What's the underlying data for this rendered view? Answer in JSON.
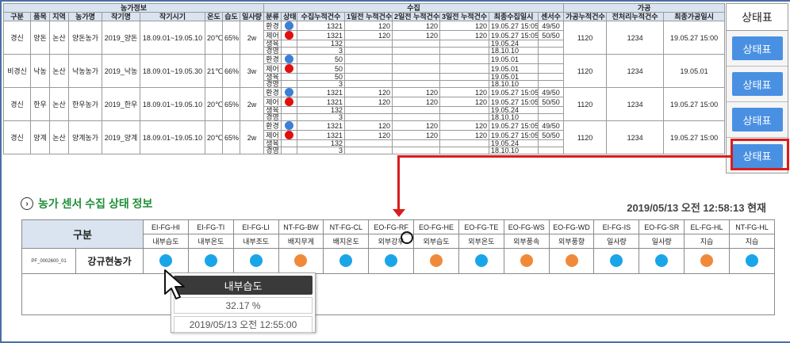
{
  "top": {
    "groups": [
      "농가정보",
      "수집",
      "가공"
    ],
    "columns": [
      "구분",
      "품목",
      "지역",
      "농가명",
      "작기명",
      "작기시기",
      "온도",
      "습도",
      "일사량",
      "분류",
      "상태",
      "수집누적건수",
      "1일전 누적건수",
      "2일전 누적건수",
      "3일전 누적건수",
      "최종수집일시",
      "센서수",
      "가공누적건수",
      "전처리누적건수",
      "최종가공일시"
    ],
    "farms": [
      {
        "gubun": "경신",
        "item": "양돈",
        "region": "논산",
        "name": "양돈농가",
        "crop": "2019_양돈",
        "period": "18.09.01~19.05.10",
        "temp": "20℃",
        "hum": "65%",
        "solar": "2w",
        "rows": [
          {
            "cls": "환경",
            "status": "blue",
            "total": "1321",
            "d1": "120",
            "d2": "120",
            "d3": "120",
            "last": "19.05.27 15:05",
            "sensors": "49/50"
          },
          {
            "cls": "제어",
            "status": "red",
            "total": "1321",
            "d1": "120",
            "d2": "120",
            "d3": "120",
            "last": "19.05.27 15:05",
            "sensors": "50/50"
          },
          {
            "cls": "생육",
            "status": "",
            "total": "132",
            "d1": "",
            "d2": "",
            "d3": "",
            "last": "19.05.24",
            "sensors": ""
          },
          {
            "cls": "경영",
            "status": "",
            "total": "3",
            "d1": "",
            "d2": "",
            "d3": "",
            "last": "18.10.10",
            "sensors": ""
          }
        ],
        "proc": "1120",
        "pre": "1234",
        "plast": "19.05.27 15:00"
      },
      {
        "gubun": "비경신",
        "item": "낙농",
        "region": "논산",
        "name": "낙농농가",
        "crop": "2019_낙농",
        "period": "18.09.01~19.05.30",
        "temp": "21℃",
        "hum": "66%",
        "solar": "3w",
        "rows": [
          {
            "cls": "환경",
            "status": "blue",
            "total": "50",
            "d1": "",
            "d2": "",
            "d3": "",
            "last": "19.05.01",
            "sensors": ""
          },
          {
            "cls": "제어",
            "status": "red",
            "total": "50",
            "d1": "",
            "d2": "",
            "d3": "",
            "last": "19.05.01",
            "sensors": ""
          },
          {
            "cls": "생육",
            "status": "",
            "total": "50",
            "d1": "",
            "d2": "",
            "d3": "",
            "last": "19.05.01",
            "sensors": ""
          },
          {
            "cls": "경영",
            "status": "",
            "total": "3",
            "d1": "",
            "d2": "",
            "d3": "",
            "last": "18.10.10",
            "sensors": ""
          }
        ],
        "proc": "1120",
        "pre": "1234",
        "plast": "19.05.01"
      },
      {
        "gubun": "경신",
        "item": "한우",
        "region": "논산",
        "name": "한우농가",
        "crop": "2019_한우",
        "period": "18.09.01~19.05.10",
        "temp": "20℃",
        "hum": "65%",
        "solar": "2w",
        "rows": [
          {
            "cls": "환경",
            "status": "blue",
            "total": "1321",
            "d1": "120",
            "d2": "120",
            "d3": "120",
            "last": "19.05.27 15:05",
            "sensors": "49/50"
          },
          {
            "cls": "제어",
            "status": "red",
            "total": "1321",
            "d1": "120",
            "d2": "120",
            "d3": "120",
            "last": "19.05.27 15:05",
            "sensors": "50/50"
          },
          {
            "cls": "생육",
            "status": "",
            "total": "132",
            "d1": "",
            "d2": "",
            "d3": "",
            "last": "19.05.24",
            "sensors": ""
          },
          {
            "cls": "경영",
            "status": "",
            "total": "3",
            "d1": "",
            "d2": "",
            "d3": "",
            "last": "18.10.10",
            "sensors": ""
          }
        ],
        "proc": "1120",
        "pre": "1234",
        "plast": "19.05.27 15:00"
      },
      {
        "gubun": "경신",
        "item": "양계",
        "region": "논산",
        "name": "양계농가",
        "crop": "2019_양계",
        "period": "18.09.01~19.05.10",
        "temp": "20℃",
        "hum": "65%",
        "solar": "2w",
        "rows": [
          {
            "cls": "환경",
            "status": "blue",
            "total": "1321",
            "d1": "120",
            "d2": "120",
            "d3": "120",
            "last": "19.05.27 15:05",
            "sensors": "49/50"
          },
          {
            "cls": "제어",
            "status": "red",
            "total": "1321",
            "d1": "120",
            "d2": "120",
            "d3": "120",
            "last": "19.05.27 15:05",
            "sensors": "50/50"
          },
          {
            "cls": "생육",
            "status": "",
            "total": "132",
            "d1": "",
            "d2": "",
            "d3": "",
            "last": "19.05.24",
            "sensors": ""
          },
          {
            "cls": "경영",
            "status": "",
            "total": "3",
            "d1": "",
            "d2": "",
            "d3": "",
            "last": "18.10.10",
            "sensors": ""
          }
        ],
        "proc": "1120",
        "pre": "1234",
        "plast": "19.05.27 15:00"
      }
    ]
  },
  "right_panel": {
    "header": "상태표",
    "button_label": "상태표"
  },
  "sensor": {
    "section_title": "농가 센서 수집 상태 정보",
    "timestamp": "2019/05/13 오전 12:58:13 현재",
    "gubun_label": "구분",
    "codes": [
      "EI-FG-HI",
      "EI-FG-TI",
      "EI-FG-LI",
      "NT-FG-BW",
      "NT-FG-CL",
      "EO-FG-RF",
      "EO-FG-HE",
      "EO-FG-TE",
      "EO-FG-WS",
      "EO-FG-WD",
      "EI-FG-IS",
      "EO-FG-SR",
      "EL-FG-HL",
      "NT-FG-HL"
    ],
    "names": [
      "내부습도",
      "내부온도",
      "내부조도",
      "배지무게",
      "배지온도",
      "외부강우",
      "외부습도",
      "외부온도",
      "외부풍속",
      "외부풍향",
      "일사량",
      "일사량",
      "지습",
      "지습"
    ],
    "row_id": "PF_0002600_01",
    "farm": "강규현농가",
    "statuses": [
      "b",
      "b",
      "b",
      "o",
      "b",
      "b",
      "o",
      "b",
      "o",
      "o",
      "b",
      "b",
      "o",
      "b"
    ]
  },
  "popup": {
    "title": "내부습도",
    "value": "32.17 %",
    "time": "2019/05/13 오전 12:55:00"
  },
  "colors": {
    "accent": "#4a90e2",
    "highlight": "#d91c1c",
    "blue_dot": "#1aa5e8",
    "orange_dot": "#f08a3a",
    "section_green": "#1f8f3a"
  }
}
